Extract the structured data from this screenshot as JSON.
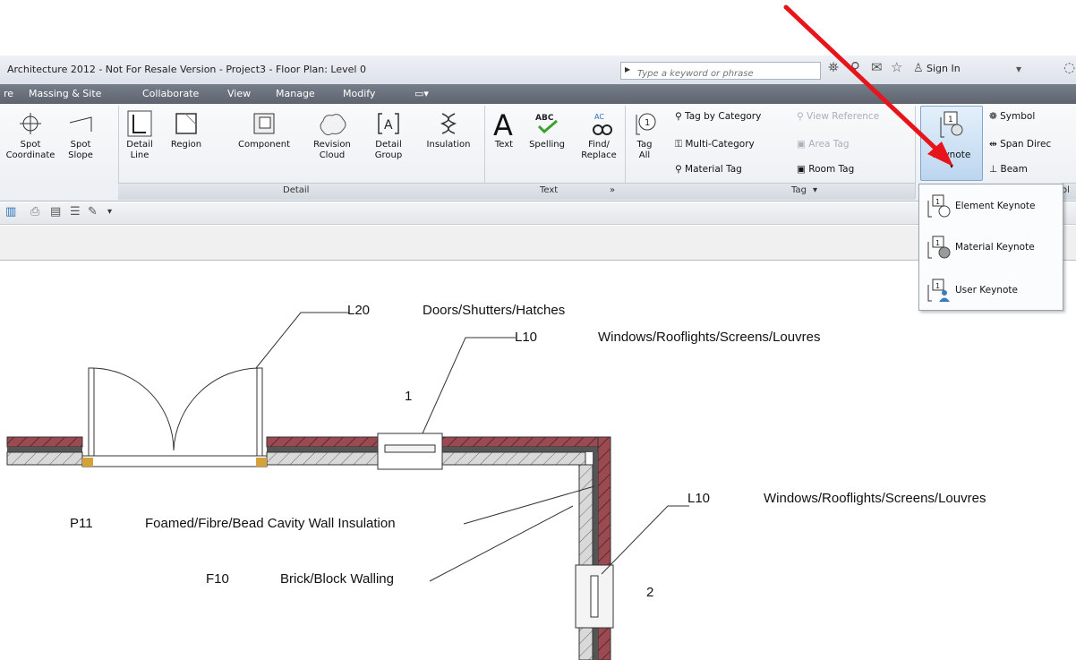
{
  "title_bar": {
    "title": "Architecture 2012 - Not For Resale Version -    Project3 - Floor Plan: Level 0",
    "search_placeholder": "Type a keyword or phrase",
    "sign_in": "Sign In"
  },
  "menu": [
    "re",
    "Massing & Site",
    "Collaborate",
    "View",
    "Manage",
    "Modify"
  ],
  "ribbon": {
    "spot_coordinate": "Spot\nCoordinate",
    "spot_slope": "Spot\nSlope",
    "detail_line": "Detail\nLine",
    "region": "Region",
    "component": "Component",
    "revision_cloud": "Revision\nCloud",
    "detail_group": "Detail\nGroup",
    "insulation": "Insulation",
    "text": "Text",
    "spelling": "Spelling",
    "find_replace": "Find/\nReplace",
    "tag_all": "Tag\nAll",
    "tag_by_category": "Tag by Category",
    "multi_category": "Multi-Category",
    "material_tag": "Material Tag",
    "view_reference": "View Reference",
    "area_tag": "Area Tag",
    "room_tag": "Room Tag",
    "keynote": "Keynote",
    "symbol": "Symbol",
    "span_direction": "Span Direc",
    "beam": "Beam",
    "panel_detail": "Detail",
    "panel_text": "Text",
    "panel_tag": "Tag",
    "panel_symbol": "ol"
  },
  "keynote_menu": [
    "Element Keynote",
    "Material Keynote",
    "User Keynote"
  ],
  "drawing": {
    "L20": "L20",
    "doors": "Doors/Shutters/Hatches",
    "L10a": "L10",
    "windows_a": "Windows/Rooflights/Screens/Louvres",
    "num1": "1",
    "L10b": "L10",
    "windows_b": "Windows/Rooflights/Screens/Louvres",
    "P11": "P11",
    "insulation_note": "Foamed/Fibre/Bead Cavity Wall Insulation",
    "F10": "F10",
    "brick_note": "Brick/Block Walling",
    "num2": "2"
  },
  "colors": {
    "arrow": "#e8141c",
    "brick": "#9b4a52",
    "menubar": "#666e79"
  }
}
